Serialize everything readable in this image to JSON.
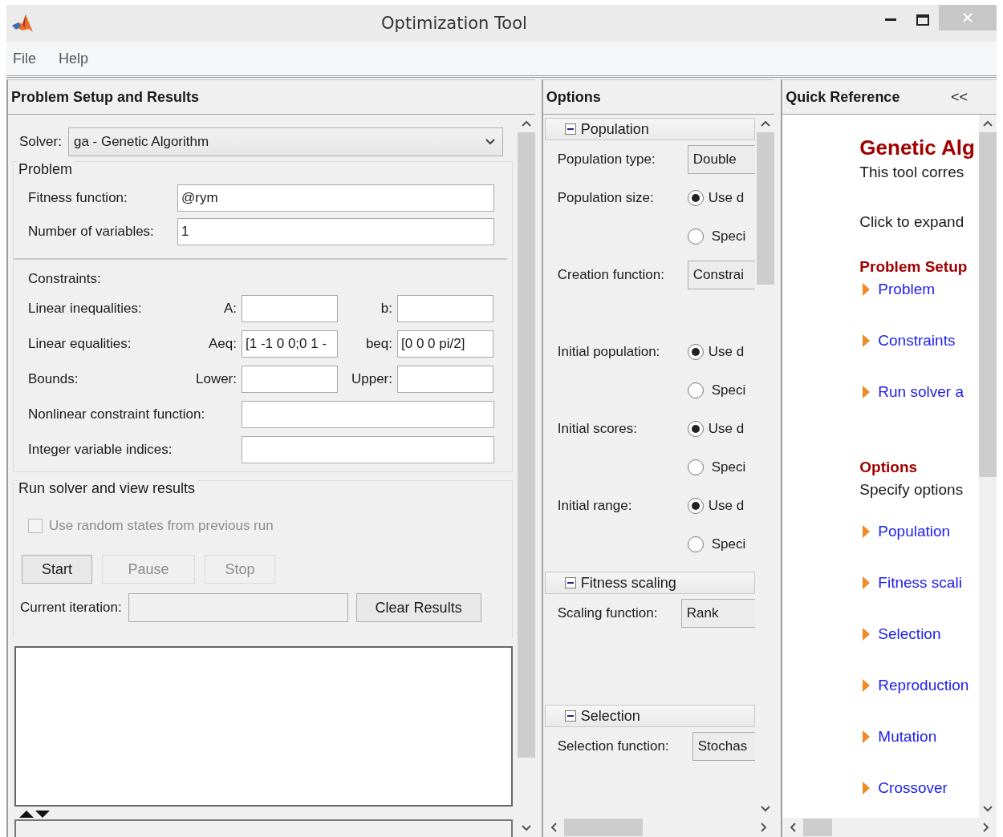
{
  "window": {
    "title": "Optimization Tool"
  },
  "menu": [
    {
      "label": "File"
    },
    {
      "label": "Help"
    }
  ],
  "problem_panel": {
    "title": "Problem Setup and Results",
    "solver": {
      "label": "Solver:",
      "value": "ga - Genetic Algorithm"
    },
    "problem": {
      "title": "Problem",
      "fields": [
        {
          "label": "Fitness function:",
          "value": "@rym"
        },
        {
          "label": "Number of variables:",
          "value": "1"
        }
      ],
      "constraints_label": "Constraints:",
      "constraints": [
        {
          "label": "Linear inequalities:",
          "kind": "pair",
          "fields": [
            {
              "label": "A:"
            },
            {
              "label": "b:"
            }
          ]
        },
        {
          "label": "Linear equalities:",
          "kind": "pair",
          "fields": [
            {
              "label": "Aeq:",
              "value": "[1 -1 0 0;0 1 -"
            },
            {
              "label": "beq:",
              "value": "[0 0 0 pi/2]"
            }
          ]
        },
        {
          "label": "Bounds:",
          "kind": "pair",
          "fields": [
            {
              "label": "Lower:"
            },
            {
              "label": "Upper:"
            }
          ]
        },
        {
          "label": "Nonlinear constraint function:",
          "kind": "single"
        },
        {
          "label": "Integer variable indices:",
          "kind": "single"
        }
      ]
    },
    "run": {
      "title": "Run solver and view results",
      "random_states": {
        "label": "Use random states from previous run",
        "checked": false,
        "disabled": true
      },
      "buttons": [
        {
          "label": "Start",
          "disabled": false
        },
        {
          "label": "Pause",
          "disabled": true
        },
        {
          "label": "Stop",
          "disabled": true
        }
      ],
      "iteration": {
        "label": "Current iteration:"
      },
      "clear_button": {
        "label": "Clear Results"
      }
    }
  },
  "options_panel": {
    "title": "Options",
    "sections": [
      {
        "title": "Population",
        "expanded": true,
        "rows": [
          {
            "label": "Population type:",
            "kind": "dropdown",
            "value": "Double"
          },
          {
            "label": "Population size:",
            "kind": "radio",
            "options": [
              {
                "text": "Use d",
                "selected": true
              },
              {
                "text": "Speci",
                "selected": false
              }
            ]
          },
          {
            "label": "Creation function:",
            "kind": "dropdown",
            "value": "Constrai"
          },
          {
            "label": "Initial population:",
            "kind": "radio",
            "options": [
              {
                "text": "Use d",
                "selected": true
              },
              {
                "text": "Speci",
                "selected": false
              }
            ]
          },
          {
            "label": "Initial scores:",
            "kind": "radio",
            "options": [
              {
                "text": "Use d",
                "selected": true
              },
              {
                "text": "Speci",
                "selected": false
              }
            ]
          },
          {
            "label": "Initial range:",
            "kind": "radio",
            "options": [
              {
                "text": "Use d",
                "selected": true
              },
              {
                "text": "Speci",
                "selected": false
              }
            ]
          }
        ]
      },
      {
        "title": "Fitness scaling",
        "expanded": true,
        "rows": [
          {
            "label": "Scaling function:",
            "kind": "dropdown",
            "value": "Rank"
          }
        ]
      },
      {
        "title": "Selection",
        "expanded": true,
        "rows": [
          {
            "label": "Selection function:",
            "kind": "dropdown",
            "value": "Stochas"
          }
        ]
      }
    ]
  },
  "quick_reference": {
    "title": "Quick Reference",
    "collapse": "<<",
    "heading": "Genetic Alg",
    "intro": "This tool corres",
    "hint": "Click to expand",
    "groups": [
      {
        "title": "Problem Setup",
        "links": [
          "Problem",
          "Constraints",
          "Run solver a"
        ]
      },
      {
        "title": "Options",
        "subtitle": "Specify options",
        "links": [
          "Population",
          "Fitness scali",
          "Selection",
          "Reproduction",
          "Mutation",
          "Crossover"
        ]
      }
    ]
  }
}
